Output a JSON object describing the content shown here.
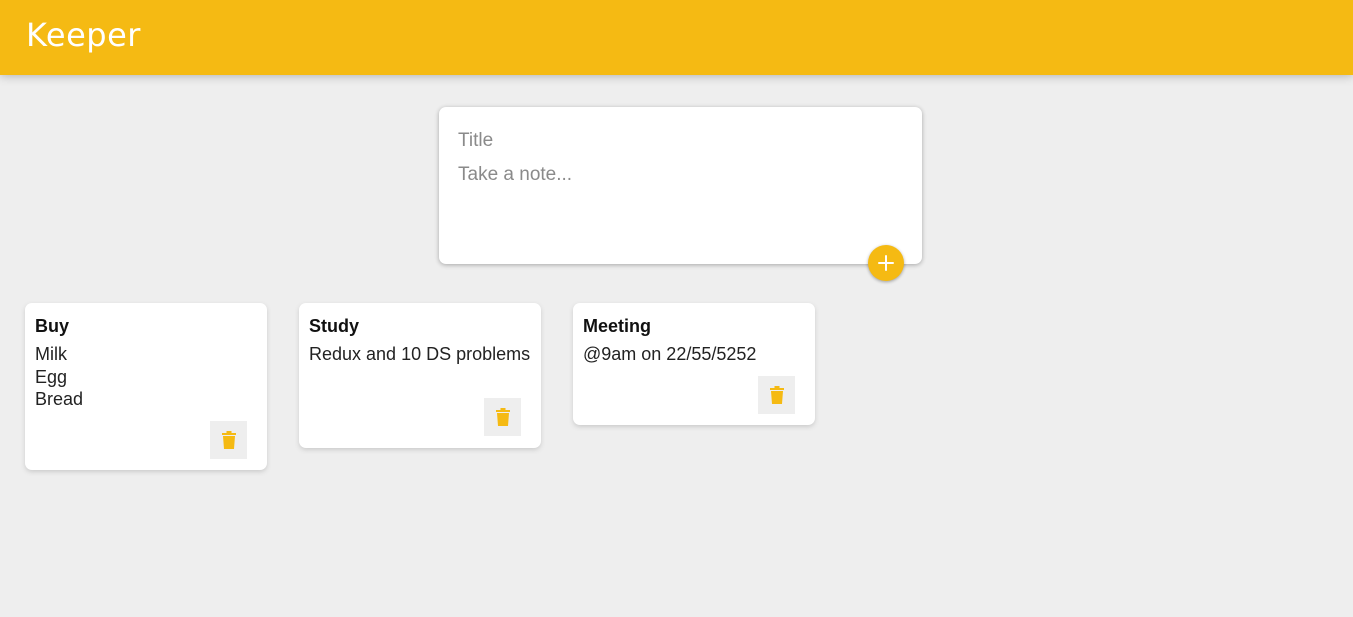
{
  "header": {
    "title": "Keeper"
  },
  "create_area": {
    "title_placeholder": "Title",
    "content_placeholder": "Take a note...",
    "add_icon": "plus-icon"
  },
  "notes": [
    {
      "title": "Buy",
      "content": "Milk\nEgg\nBread",
      "delete_icon": "trash-icon"
    },
    {
      "title": "Study",
      "content": "Redux and 10 DS problems",
      "delete_icon": "trash-icon"
    },
    {
      "title": "Meeting",
      "content": "@9am on 22/55/5252",
      "delete_icon": "trash-icon"
    }
  ],
  "colors": {
    "accent": "#f5ba13",
    "background": "#eeeeee",
    "card": "#ffffff"
  }
}
